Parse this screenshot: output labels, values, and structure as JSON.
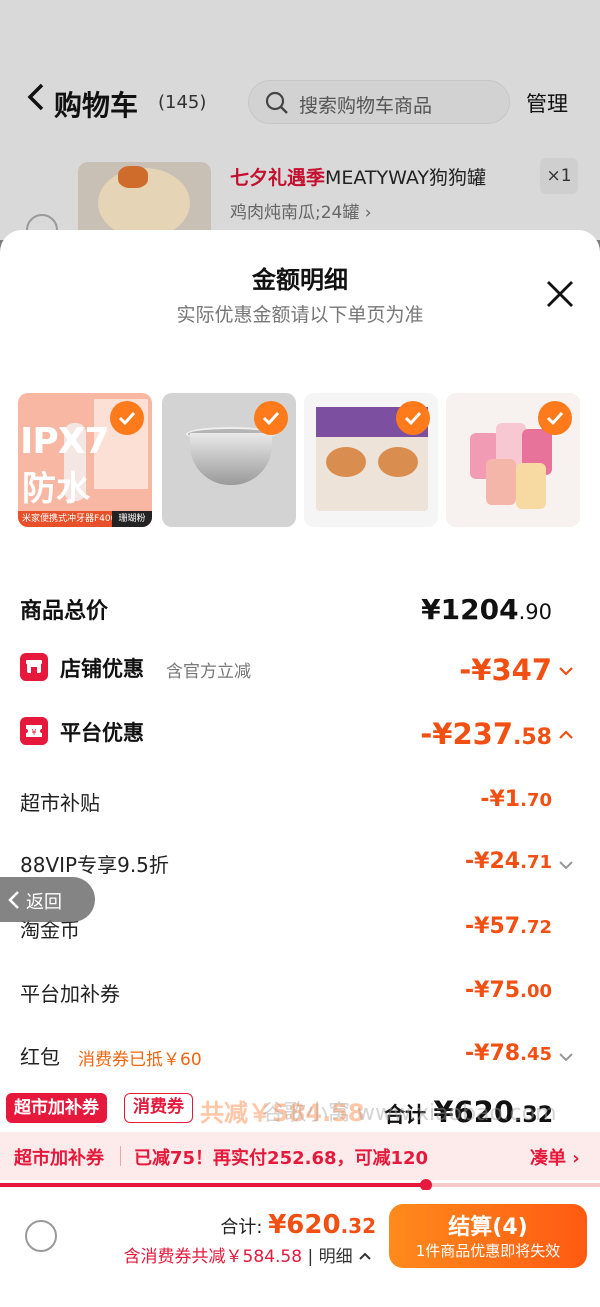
{
  "background_cart": {
    "title": "购物车",
    "count": "(145)",
    "search_placeholder": "搜索购物车商品",
    "manage": "管理",
    "item": {
      "promo": "七夕礼遇季",
      "name": "MEATYWAY狗狗罐",
      "sku": "鸡肉炖南瓜;24罐 ›",
      "qty": "×1"
    }
  },
  "sheet": {
    "title": "金额明细",
    "subtitle": "实际优惠金额请以下单页为准",
    "products": [
      {
        "name": "米家便携式冲牙器F400",
        "big1": "IPX7",
        "big2": "防水",
        "tag": "珊瑚粉",
        "checked": true
      },
      {
        "name": "不锈钢盆",
        "checked": true
      },
      {
        "name": "猫粮",
        "checked": true
      },
      {
        "name": "猫条零食",
        "checked": true
      }
    ],
    "total": {
      "label": "商品总价",
      "currency": "¥",
      "int": "1204",
      "dec": ".90"
    },
    "shop_discount": {
      "label": "店铺优惠",
      "note": "含官方立减",
      "amount_int": "-¥347",
      "amount_dec": ""
    },
    "platform_discount": {
      "label": "平台优惠",
      "amount_int": "-¥237",
      "amount_dec": ".58"
    },
    "details": [
      {
        "label": "超市补贴",
        "extra": "",
        "int": "-¥1",
        "dec": ".70",
        "chevron": false
      },
      {
        "label": "88VIP专享9.5折",
        "extra": "",
        "int": "-¥24",
        "dec": ".71",
        "chevron": true
      },
      {
        "label": "淘金币",
        "extra": "",
        "int": "-¥57",
        "dec": ".72",
        "chevron": false
      },
      {
        "label": "平台加补券",
        "extra": "",
        "int": "-¥75",
        "dec": ".00",
        "chevron": false
      },
      {
        "label": "红包",
        "extra": "消费券已抵￥60",
        "int": "-¥78",
        "dec": ".45",
        "chevron": true
      }
    ],
    "back_label": "返回"
  },
  "float_band": {
    "tag1": "超市加补券",
    "tag2": "消费券",
    "ghost_save": "共减￥584.58",
    "ghost_total_label": "合计",
    "ghost_total_cur": "¥",
    "ghost_total_int": "620",
    "ghost_total_dec": ".32",
    "watermark": "谷歌小窝 www.xiaobao.com"
  },
  "promo_bar": {
    "tag": "超市加补券",
    "message": "已减75！再实付252.68，可减120",
    "action": "凑单 ›",
    "progress": 0.71
  },
  "footer": {
    "total_label": "合计: ",
    "total_int": "¥620",
    "total_dec": ".32",
    "detail_text": "含消费券共减￥584.58",
    "detail_link": "明细",
    "checkout": "结算(4)",
    "checkout_hint": "1件商品优惠即将失效"
  },
  "colors": {
    "accent": "#f24f12",
    "brand_red": "#e6183b",
    "checkout": "#ff6a14"
  }
}
